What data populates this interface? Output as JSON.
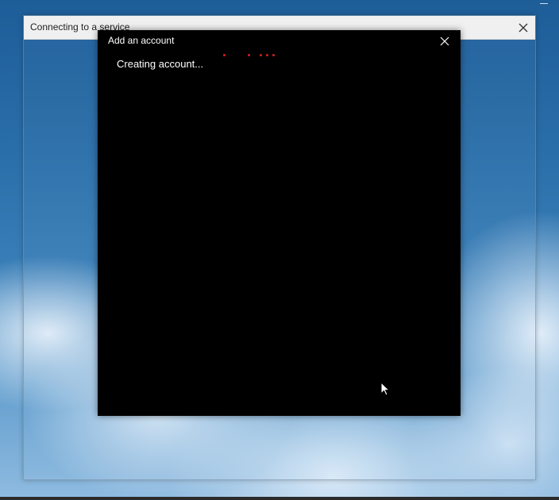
{
  "colors": {
    "progress_dot": "#d8201e",
    "dialog_background": "#000000",
    "outer_titlebar": "#f0f0f0"
  },
  "outer_window": {
    "title": "Connecting to a service",
    "close_icon": "close-icon"
  },
  "inner_dialog": {
    "title": "Add an account",
    "close_icon": "close-icon",
    "status": "Creating account..."
  },
  "progress": {
    "style": "indeterminate-dots",
    "dot_count": 5
  },
  "pointer": {
    "icon": "mouse-cursor-icon"
  }
}
